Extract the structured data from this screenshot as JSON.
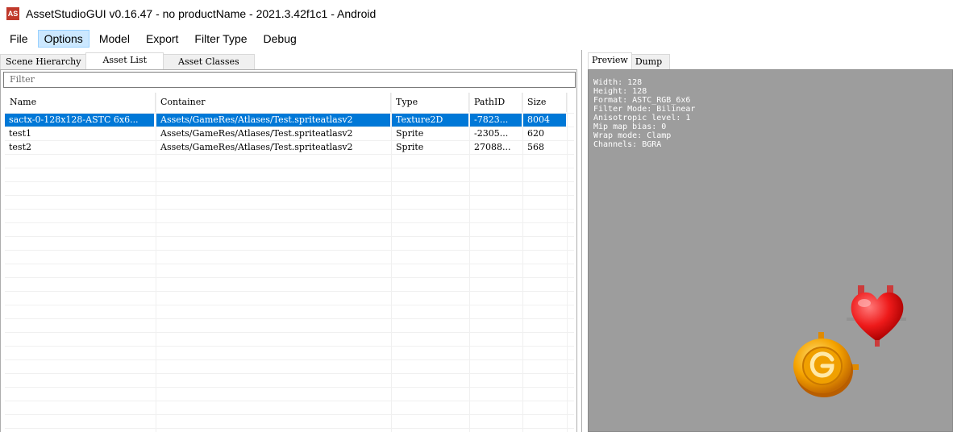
{
  "window": {
    "icon_label": "AS",
    "title": "AssetStudioGUI v0.16.47 - no productName - 2021.3.42f1c1 - Android"
  },
  "menu": [
    {
      "label": "File",
      "active": false
    },
    {
      "label": "Options",
      "active": true
    },
    {
      "label": "Model",
      "active": false
    },
    {
      "label": "Export",
      "active": false
    },
    {
      "label": "Filter Type",
      "active": false
    },
    {
      "label": "Debug",
      "active": false
    }
  ],
  "left_tabs": [
    {
      "label": "Scene Hierarchy",
      "active": false
    },
    {
      "label": "Asset List",
      "active": true
    },
    {
      "label": "Asset Classes",
      "active": false
    }
  ],
  "filter": {
    "placeholder": "Filter"
  },
  "table": {
    "columns": [
      "Name",
      "Container",
      "Type",
      "PathID",
      "Size"
    ],
    "rows": [
      {
        "name": "sactx-0-128x128-ASTC 6x6...",
        "container": "Assets/GameRes/Atlases/Test.spriteatlasv2",
        "type": "Texture2D",
        "path_id": "-7823...",
        "size": "8004",
        "selected": true
      },
      {
        "name": "test1",
        "container": "Assets/GameRes/Atlases/Test.spriteatlasv2",
        "type": "Sprite",
        "path_id": "-2305...",
        "size": "620",
        "selected": false
      },
      {
        "name": "test2",
        "container": "Assets/GameRes/Atlases/Test.spriteatlasv2",
        "type": "Sprite",
        "path_id": "27088...",
        "size": "568",
        "selected": false
      }
    ]
  },
  "right_tabs": [
    {
      "label": "Preview",
      "active": true
    },
    {
      "label": "Dump",
      "active": false
    }
  ],
  "preview": {
    "info_lines": [
      "Width: 128",
      "Height: 128",
      "Format: ASTC_RGB_6x6",
      "Filter Mode: Bilinear",
      "Anisotropic level: 1",
      "Mip map bias: 0",
      "Wrap mode: Clamp",
      "Channels: BGRA"
    ],
    "sprites": [
      "heart-sprite",
      "coin-sprite"
    ]
  },
  "colors": {
    "selection": "#0078d7",
    "menu_active": "#cce8ff",
    "preview_bg": "#9d9d9d"
  }
}
